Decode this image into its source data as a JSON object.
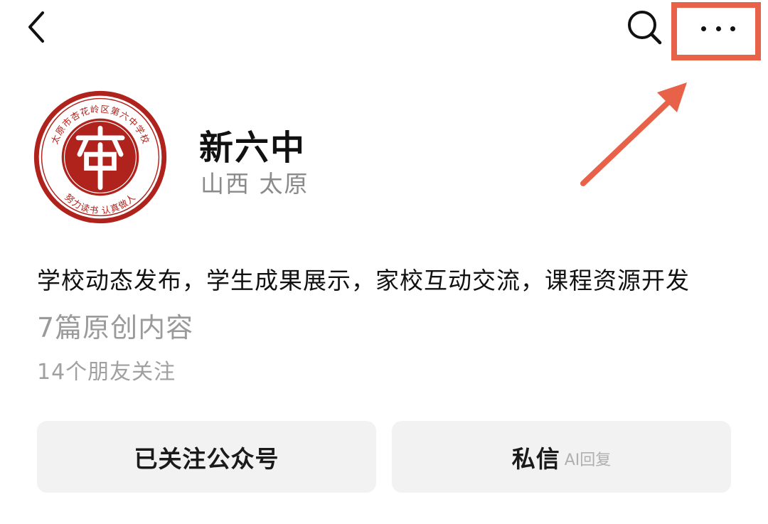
{
  "header": {
    "back_icon": "chevron-left-icon",
    "search_icon": "search-icon",
    "more_icon": "more-horizontal-icon"
  },
  "highlight_color": "#e8624a",
  "account": {
    "logo_top_text": "太原市杏花岭区第六中学校",
    "logo_bottom_text": "努力读书 认真做人",
    "logo_color": "#b0221c",
    "name": "新六中",
    "location": "山西 太原",
    "description": "学校动态发布，学生成果展示，家校互动交流，课程资源开发",
    "articles": "7篇原创内容",
    "friends": "14个朋友关注"
  },
  "actions": {
    "follow_label": "已关注公众号",
    "message_label": "私信",
    "message_sub": "AI回复"
  }
}
